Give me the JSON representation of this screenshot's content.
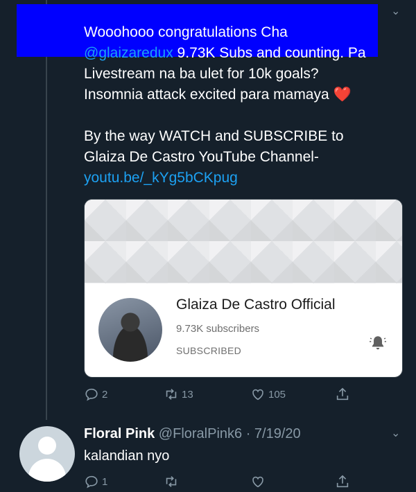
{
  "tweet": {
    "line1": "Wooohooo congratulations Cha",
    "mention": "@glaizaredux",
    "line2_rest": " 9.73K Subs and counting. Pa",
    "line3": "Livestream na ba ulet for 10k goals?",
    "line4": "Insomnia attack excited para mamaya ",
    "heart_emoji": "❤️",
    "line5": "By the way WATCH and SUBSCRIBE to",
    "line6": "Glaiza De Castro YouTube Channel-",
    "link": "youtu.be/_kYg5bCKpug"
  },
  "card": {
    "channel_name": "Glaiza De Castro Official",
    "subscribers": "9.73K subscribers",
    "status": "SUBSCRIBED"
  },
  "actions": {
    "replies": "2",
    "retweets": "13",
    "likes": "105"
  },
  "reply": {
    "name": "Floral Pink",
    "meta": " @FloralPink6 · 7/19/20",
    "text": "kalandian nyo",
    "replies": "1"
  },
  "colors": {
    "background": "#15202b",
    "link": "#1da1f2",
    "muted": "#8899a6",
    "redaction": "#0000ff"
  }
}
